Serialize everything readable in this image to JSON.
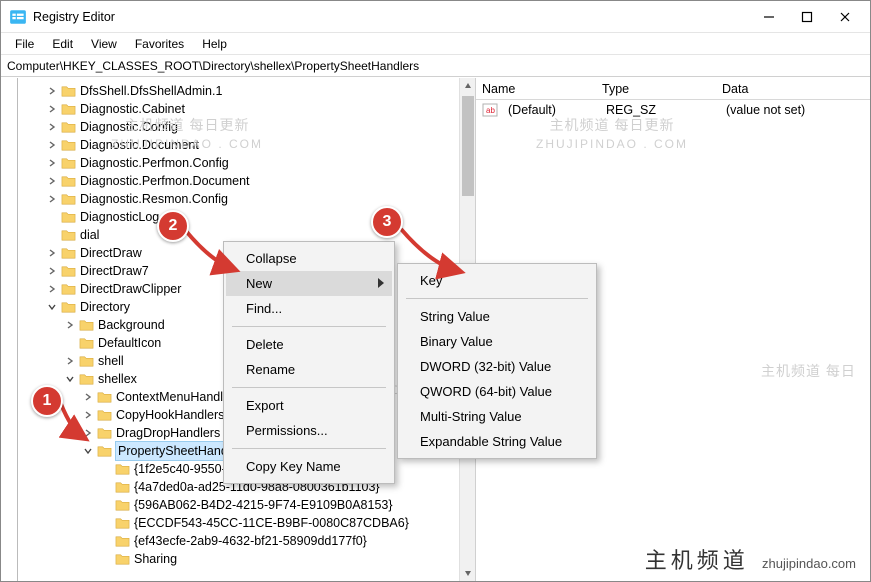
{
  "window": {
    "title": "Registry Editor"
  },
  "menubar": [
    "File",
    "Edit",
    "View",
    "Favorites",
    "Help"
  ],
  "address": "Computer\\HKEY_CLASSES_ROOT\\Directory\\shellex\\PropertySheetHandlers",
  "tree": {
    "items": [
      {
        "depth": 2,
        "exp": "closed",
        "label": "DfsShell.DfsShellAdmin.1"
      },
      {
        "depth": 2,
        "exp": "closed",
        "label": "Diagnostic.Cabinet"
      },
      {
        "depth": 2,
        "exp": "closed",
        "label": "Diagnostic.Config"
      },
      {
        "depth": 2,
        "exp": "closed",
        "label": "Diagnostic.Document"
      },
      {
        "depth": 2,
        "exp": "closed",
        "label": "Diagnostic.Perfmon.Config"
      },
      {
        "depth": 2,
        "exp": "closed",
        "label": "Diagnostic.Perfmon.Document"
      },
      {
        "depth": 2,
        "exp": "closed",
        "label": "Diagnostic.Resmon.Config"
      },
      {
        "depth": 2,
        "exp": "none",
        "label": "DiagnosticLog"
      },
      {
        "depth": 2,
        "exp": "none",
        "label": "dial"
      },
      {
        "depth": 2,
        "exp": "closed",
        "label": "DirectDraw"
      },
      {
        "depth": 2,
        "exp": "closed",
        "label": "DirectDraw7"
      },
      {
        "depth": 2,
        "exp": "closed",
        "label": "DirectDrawClipper"
      },
      {
        "depth": 2,
        "exp": "open",
        "label": "Directory"
      },
      {
        "depth": 3,
        "exp": "closed",
        "label": "Background"
      },
      {
        "depth": 3,
        "exp": "none",
        "label": "DefaultIcon"
      },
      {
        "depth": 3,
        "exp": "closed",
        "label": "shell"
      },
      {
        "depth": 3,
        "exp": "open",
        "label": "shellex"
      },
      {
        "depth": 4,
        "exp": "closed",
        "label": "ContextMenuHandlers"
      },
      {
        "depth": 4,
        "exp": "closed",
        "label": "CopyHookHandlers"
      },
      {
        "depth": 4,
        "exp": "closed",
        "label": "DragDropHandlers"
      },
      {
        "depth": 4,
        "exp": "open",
        "label": "PropertySheetHandlers",
        "selected": true
      },
      {
        "depth": 5,
        "exp": "none",
        "label": "{1f2e5c40-9550-11ce-99d2-00aa006e086c}"
      },
      {
        "depth": 5,
        "exp": "none",
        "label": "{4a7ded0a-ad25-11d0-98a8-0800361b1103}"
      },
      {
        "depth": 5,
        "exp": "none",
        "label": "{596AB062-B4D2-4215-9F74-E9109B0A8153}"
      },
      {
        "depth": 5,
        "exp": "none",
        "label": "{ECCDF543-45CC-11CE-B9BF-0080C87CDBA6}"
      },
      {
        "depth": 5,
        "exp": "none",
        "label": "{ef43ecfe-2ab9-4632-bf21-58909dd177f0}"
      },
      {
        "depth": 5,
        "exp": "none",
        "label": "Sharing"
      }
    ]
  },
  "values": {
    "headers": {
      "name": "Name",
      "type": "Type",
      "data": "Data"
    },
    "rows": [
      {
        "name": "(Default)",
        "type": "REG_SZ",
        "data": "(value not set)"
      }
    ]
  },
  "context_menu": {
    "items": [
      {
        "label": "Collapse",
        "type": "item"
      },
      {
        "label": "New",
        "type": "submenu",
        "hover": true
      },
      {
        "label": "Find...",
        "type": "item"
      },
      {
        "type": "sep"
      },
      {
        "label": "Delete",
        "type": "item"
      },
      {
        "label": "Rename",
        "type": "item"
      },
      {
        "type": "sep"
      },
      {
        "label": "Export",
        "type": "item"
      },
      {
        "label": "Permissions...",
        "type": "item"
      },
      {
        "type": "sep"
      },
      {
        "label": "Copy Key Name",
        "type": "item"
      }
    ],
    "new_submenu": [
      "Key",
      "String Value",
      "Binary Value",
      "DWORD (32-bit) Value",
      "QWORD (64-bit) Value",
      "Multi-String Value",
      "Expandable String Value"
    ]
  },
  "annotations": {
    "b1": "1",
    "b2": "2",
    "b3": "3"
  },
  "watermark": {
    "cn": "主机频道 每日更新",
    "en": "ZHUJIPINDAO . COM"
  },
  "watermark2": {
    "cn": "主机频道 每日"
  },
  "footer": {
    "brand": "主机频道",
    "url": "zhujipindao.com"
  }
}
